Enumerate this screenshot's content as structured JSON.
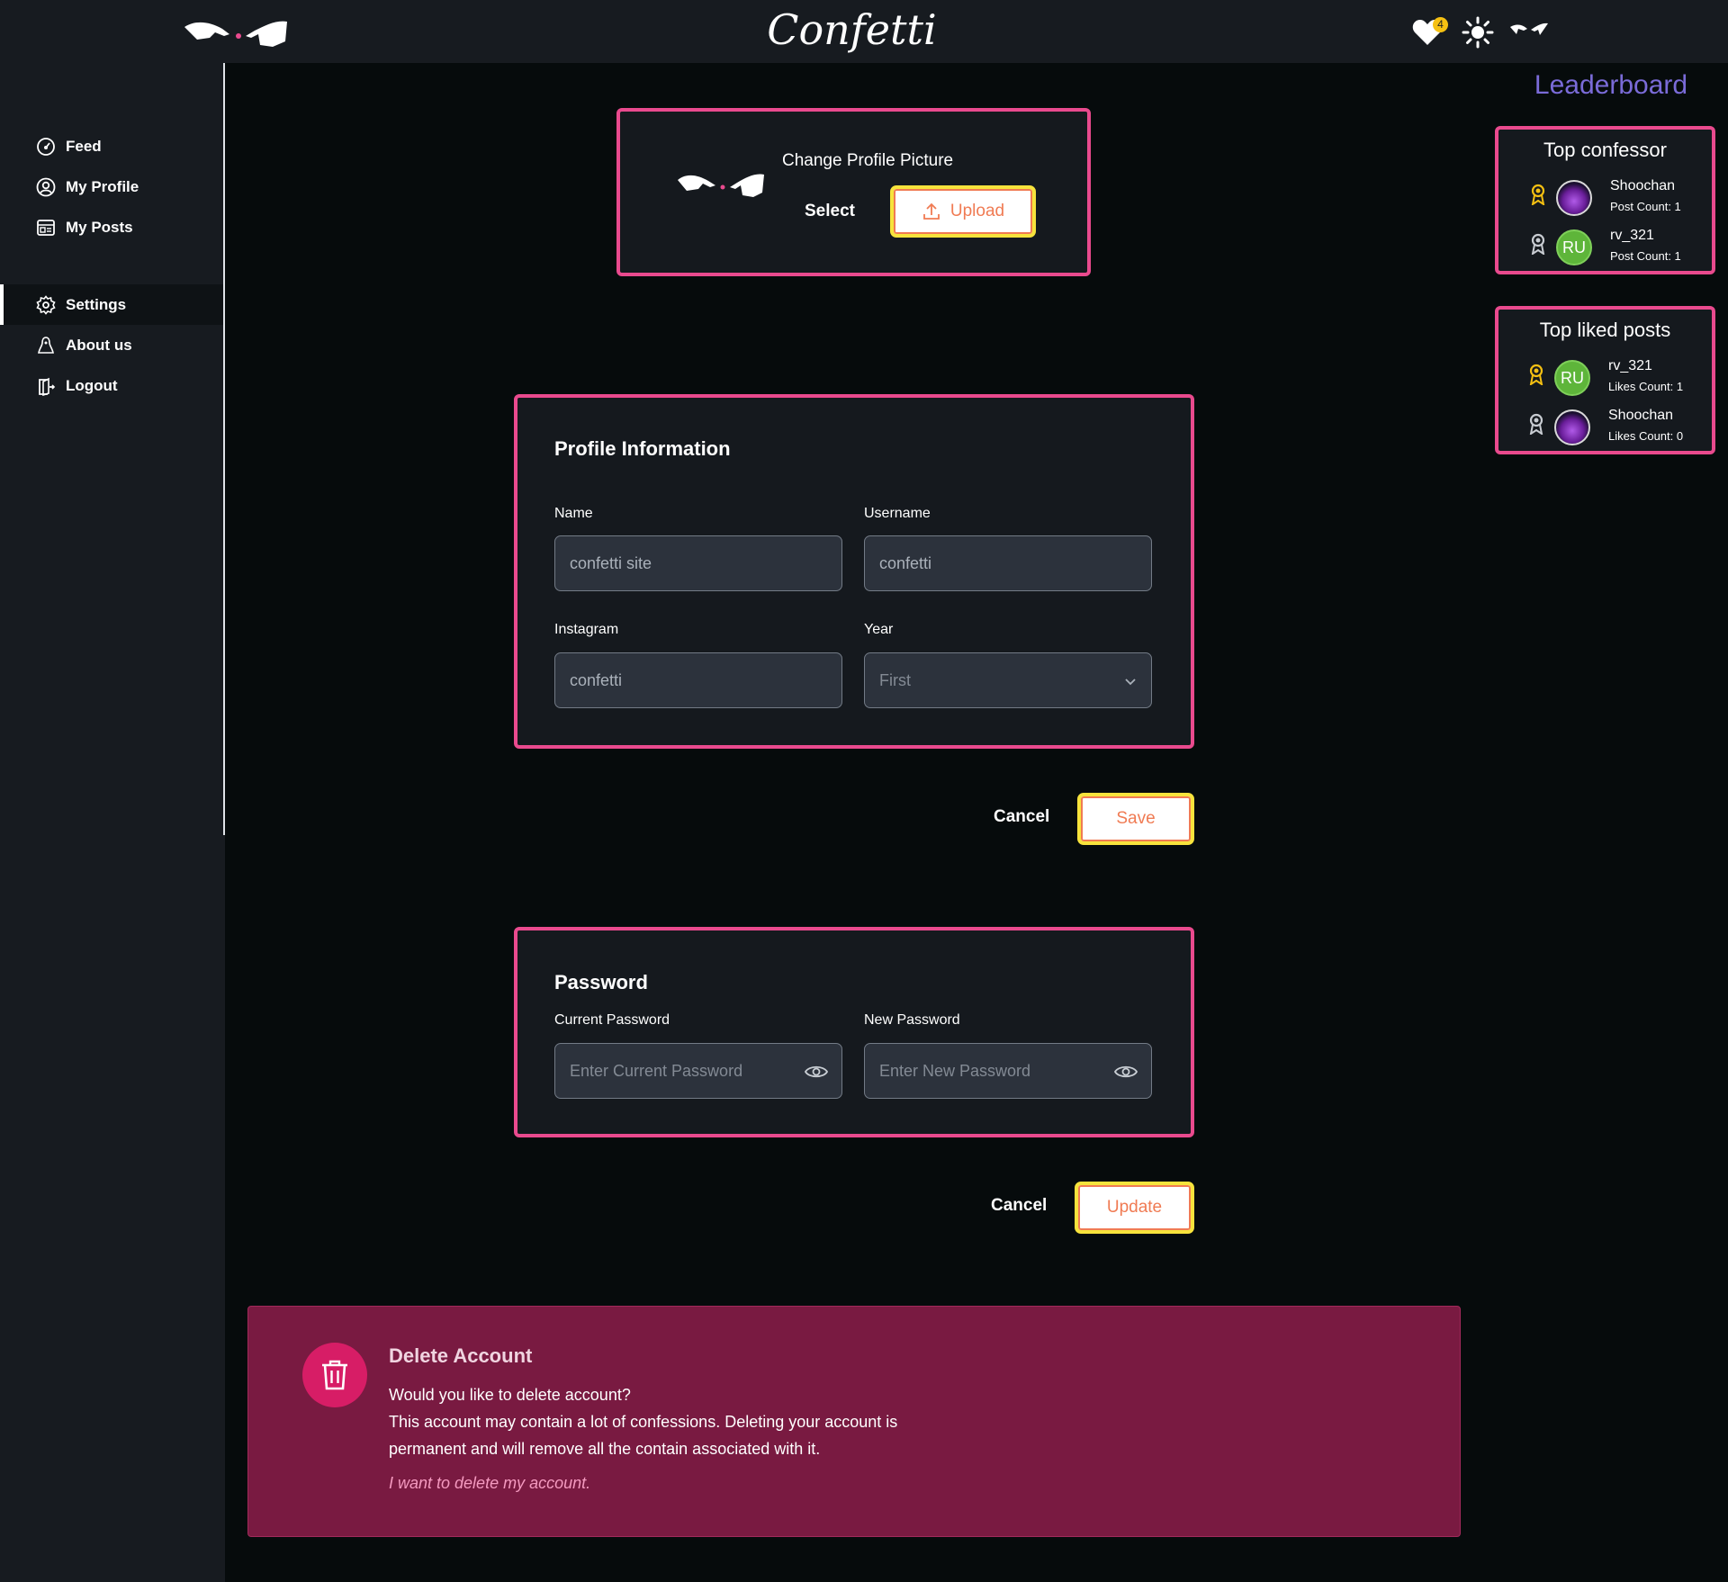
{
  "header": {
    "brand": "Confetti",
    "notification_count": "4"
  },
  "sidebar": {
    "items": [
      {
        "label": "Feed",
        "icon": "gauge-icon"
      },
      {
        "label": "My Profile",
        "icon": "user-circle-icon"
      },
      {
        "label": "My Posts",
        "icon": "posts-icon"
      },
      {
        "label": "Settings",
        "icon": "gear-icon",
        "active": true
      },
      {
        "label": "About us",
        "icon": "about-icon"
      },
      {
        "label": "Logout",
        "icon": "logout-icon"
      }
    ]
  },
  "profile_picture": {
    "title": "Change Profile Picture",
    "select_label": "Select",
    "upload_label": "Upload"
  },
  "profile_info": {
    "heading": "Profile Information",
    "name_label": "Name",
    "name_value": "confetti site",
    "username_label": "Username",
    "username_value": "confetti",
    "instagram_label": "Instagram",
    "instagram_value": "confetti",
    "year_label": "Year",
    "year_value": "First",
    "cancel_label": "Cancel",
    "save_label": "Save"
  },
  "password": {
    "heading": "Password",
    "current_label": "Current Password",
    "current_placeholder": "Enter Current Password",
    "new_label": "New Password",
    "new_placeholder": "Enter New Password",
    "cancel_label": "Cancel",
    "update_label": "Update"
  },
  "delete_account": {
    "title": "Delete Account",
    "question": "Would you like to delete account?",
    "line1": "This account may contain a lot of confessions. Deleting your account is",
    "line2": "permanent and will remove all the contain associated with it.",
    "link": "I want to delete my account."
  },
  "leaderboard": {
    "title": "Leaderboard",
    "top_confessor": {
      "heading": "Top confessor",
      "entries": [
        {
          "name": "Shoochan",
          "count": "Post Count: 1",
          "medal": "gold",
          "avatar": "purple"
        },
        {
          "name": "rv_321",
          "count": "Post Count: 1",
          "medal": "silver",
          "avatar": "RU"
        }
      ]
    },
    "top_liked": {
      "heading": "Top liked posts",
      "entries": [
        {
          "name": "rv_321",
          "count": "Likes Count: 1",
          "medal": "gold",
          "avatar": "RU"
        },
        {
          "name": "Shoochan",
          "count": "Likes Count: 0",
          "medal": "silver",
          "avatar": "purple"
        }
      ]
    }
  },
  "colors": {
    "accent_pink": "#e94a8e",
    "button_text": "#f07b53",
    "button_border": "#f7e33c",
    "leaderboard_title": "#7a6bd8",
    "delete_bg": "#791a41"
  }
}
